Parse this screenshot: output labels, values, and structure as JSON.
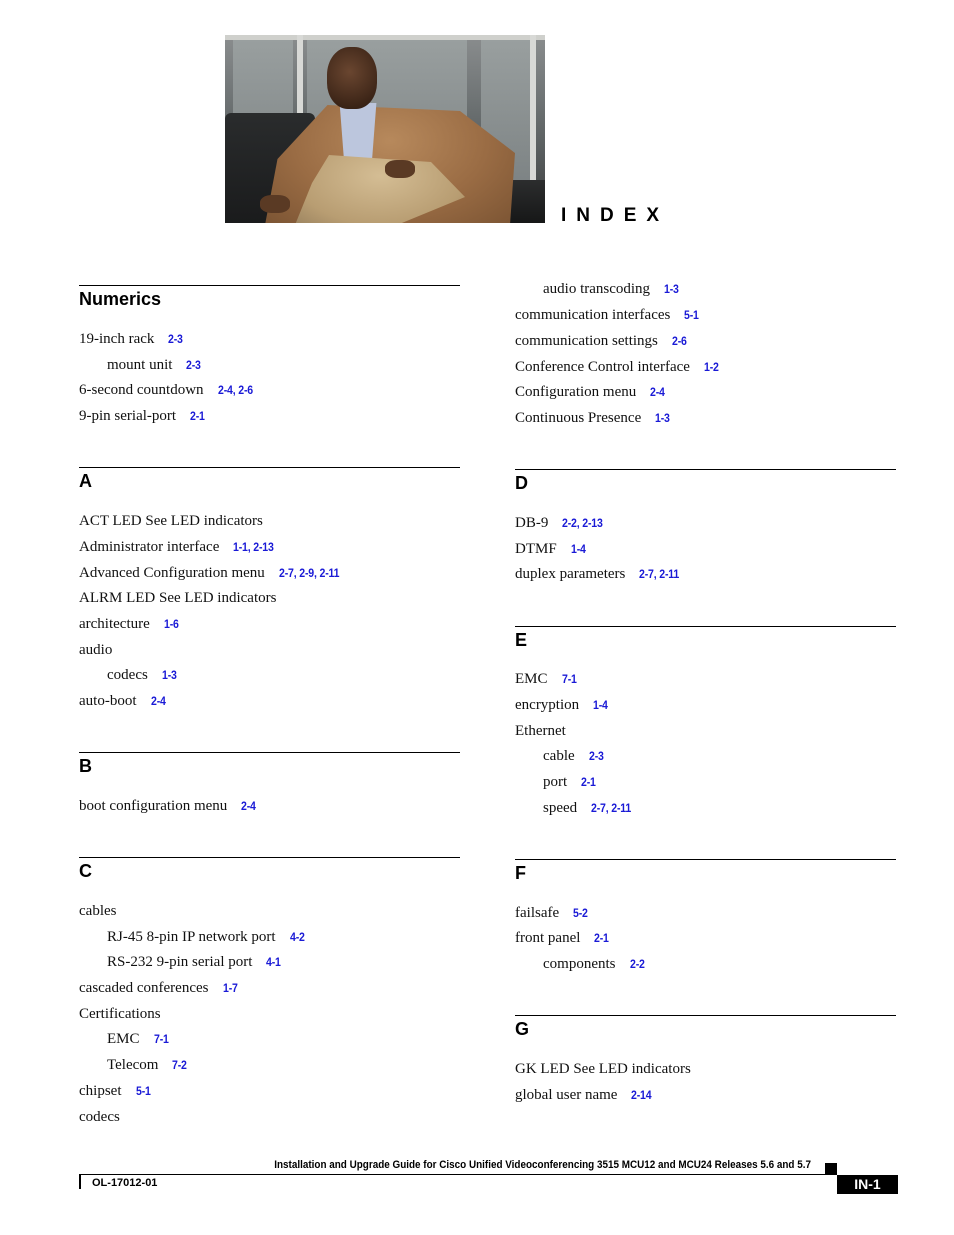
{
  "header": {
    "photo_alt": "Man in tan jacket seated on a black leather couch",
    "title": "INDEX"
  },
  "left_column": {
    "sections": [
      {
        "heading": "Numerics",
        "entries": [
          {
            "term": "19-inch rack",
            "refs": "2-3",
            "level": 1
          },
          {
            "term": "mount unit",
            "refs": "2-3",
            "level": 2
          },
          {
            "term": "6-second countdown",
            "refs": "2-4, 2-6",
            "level": 1
          },
          {
            "term": "9-pin serial-port",
            "refs": "2-1",
            "level": 1
          }
        ]
      },
      {
        "heading": "A",
        "entries": [
          {
            "term": "ACT LED See LED indicators",
            "refs": "",
            "level": 1
          },
          {
            "term": "Administrator interface",
            "refs": "1-1, 2-13",
            "level": 1
          },
          {
            "term": "Advanced Configuration menu",
            "refs": "2-7, 2-9, 2-11",
            "level": 1
          },
          {
            "term": "ALRM LED See LED indicators",
            "refs": "",
            "level": 1
          },
          {
            "term": "architecture",
            "refs": "1-6",
            "level": 1
          },
          {
            "term": "audio",
            "refs": "",
            "level": 1
          },
          {
            "term": "codecs",
            "refs": "1-3",
            "level": 2
          },
          {
            "term": "auto-boot",
            "refs": "2-4",
            "level": 1
          }
        ]
      },
      {
        "heading": "B",
        "entries": [
          {
            "term": "boot configuration menu",
            "refs": "2-4",
            "level": 1
          }
        ]
      },
      {
        "heading": "C",
        "entries": [
          {
            "term": "cables",
            "refs": "",
            "level": 1
          },
          {
            "term": "RJ-45 8-pin IP network port",
            "refs": "4-2",
            "level": 2
          },
          {
            "term": "RS-232 9-pin serial port",
            "refs": "4-1",
            "level": 2
          },
          {
            "term": "cascaded conferences",
            "refs": "1-7",
            "level": 1
          },
          {
            "term": "Certifications",
            "refs": "",
            "level": 1
          },
          {
            "term": "EMC",
            "refs": "7-1",
            "level": 2
          },
          {
            "term": "Telecom",
            "refs": "7-2",
            "level": 2
          },
          {
            "term": "chipset",
            "refs": "5-1",
            "level": 1
          },
          {
            "term": "codecs",
            "refs": "",
            "level": 1
          }
        ]
      }
    ]
  },
  "right_column": {
    "continued_entries": [
      {
        "term": "audio transcoding",
        "refs": "1-3",
        "level": 2
      },
      {
        "term": "communication interfaces",
        "refs": "5-1",
        "level": 1
      },
      {
        "term": "communication settings",
        "refs": "2-6",
        "level": 1
      },
      {
        "term": "Conference Control interface",
        "refs": "1-2",
        "level": 1
      },
      {
        "term": "Configuration menu",
        "refs": "2-4",
        "level": 1
      },
      {
        "term": "Continuous Presence",
        "refs": "1-3",
        "level": 1
      }
    ],
    "sections": [
      {
        "heading": "D",
        "entries": [
          {
            "term": "DB-9",
            "refs": "2-2, 2-13",
            "level": 1
          },
          {
            "term": "DTMF",
            "refs": "1-4",
            "level": 1
          },
          {
            "term": "duplex parameters",
            "refs": "2-7, 2-11",
            "level": 1
          }
        ]
      },
      {
        "heading": "E",
        "entries": [
          {
            "term": "EMC",
            "refs": "7-1",
            "level": 1
          },
          {
            "term": "encryption",
            "refs": "1-4",
            "level": 1
          },
          {
            "term": "Ethernet",
            "refs": "",
            "level": 1
          },
          {
            "term": "cable",
            "refs": "2-3",
            "level": 2
          },
          {
            "term": "port",
            "refs": "2-1",
            "level": 2
          },
          {
            "term": "speed",
            "refs": "2-7, 2-11",
            "level": 2
          }
        ]
      },
      {
        "heading": "F",
        "entries": [
          {
            "term": "failsafe",
            "refs": "5-2",
            "level": 1
          },
          {
            "term": "front panel",
            "refs": "2-1",
            "level": 1
          },
          {
            "term": "components",
            "refs": "2-2",
            "level": 2
          }
        ]
      },
      {
        "heading": "G",
        "entries": [
          {
            "term": "GK LED See LED indicators",
            "refs": "",
            "level": 1
          },
          {
            "term": "global user name",
            "refs": "2-14",
            "level": 1
          }
        ]
      }
    ]
  },
  "footer": {
    "guide_title": "Installation and Upgrade Guide for Cisco Unified Videoconferencing 3515 MCU12 and MCU24 Releases 5.6 and 5.7",
    "doc_number": "OL-17012-01",
    "page_number": "IN-1"
  },
  "colors": {
    "link": "#1a1ad6",
    "text": "#111111",
    "rule": "#000000"
  }
}
